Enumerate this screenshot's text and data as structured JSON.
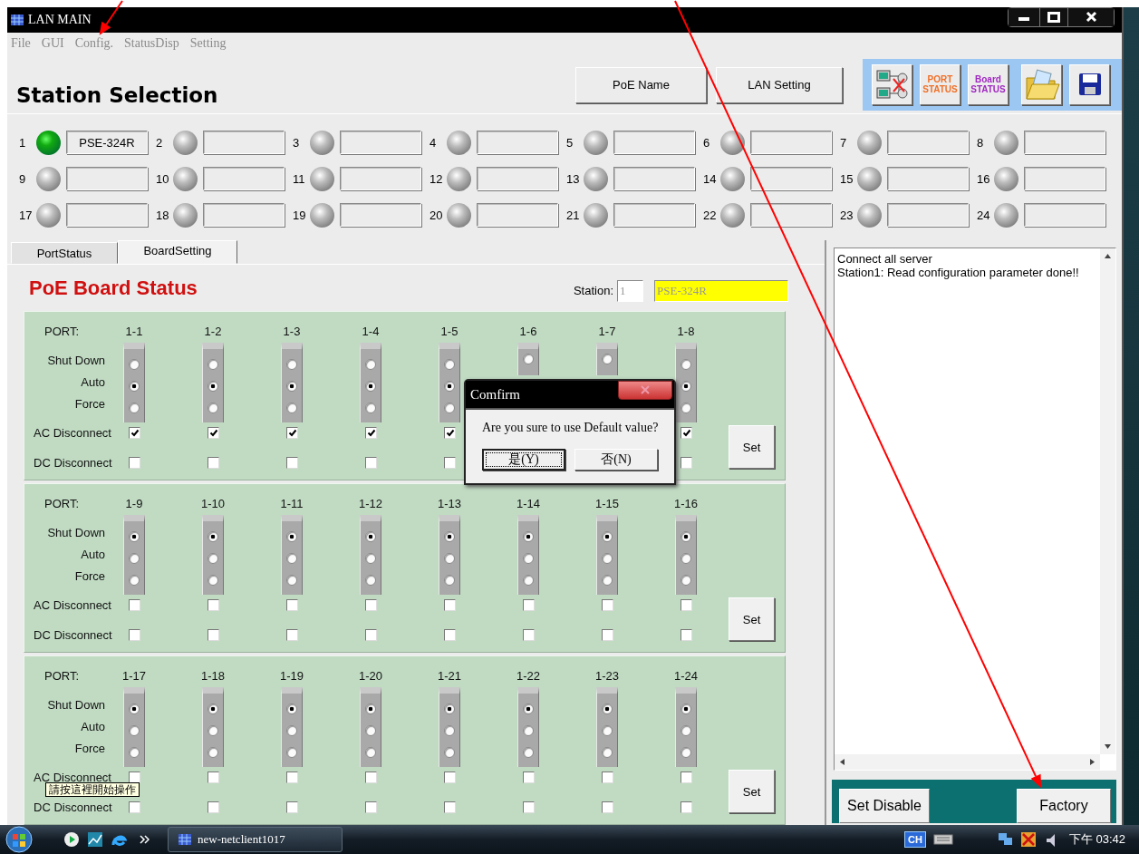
{
  "window": {
    "title": "LAN MAIN"
  },
  "menu": [
    {
      "label": "File",
      "disabled": true
    },
    {
      "label": "GUI",
      "disabled": true
    },
    {
      "label": "Config.",
      "disabled": true
    },
    {
      "label": "StatusDisp",
      "disabled": true
    },
    {
      "label": "Setting",
      "disabled": true
    }
  ],
  "header": {
    "title": "Station Selection",
    "buttons": [
      "PoE Name",
      "LAN Setting"
    ]
  },
  "toolbar": [
    {
      "kind": "network"
    },
    {
      "kind": "label",
      "lines": [
        "PORT",
        "STATUS"
      ],
      "color": "#f07028"
    },
    {
      "kind": "label",
      "lines": [
        "Board",
        "STATUS"
      ],
      "color": "#a028c0"
    },
    {
      "kind": "folder"
    },
    {
      "kind": "save"
    }
  ],
  "stations": [
    {
      "number": "1",
      "name": "PSE-324R",
      "online": true
    },
    {
      "number": "2",
      "online": false
    },
    {
      "number": "3",
      "online": false
    },
    {
      "number": "4",
      "online": false
    },
    {
      "number": "5",
      "online": false
    },
    {
      "number": "6",
      "online": false
    },
    {
      "number": "7",
      "online": false
    },
    {
      "number": "8",
      "online": false
    },
    {
      "number": "9",
      "online": false
    },
    {
      "number": "10",
      "online": false
    },
    {
      "number": "11",
      "online": false
    },
    {
      "number": "12",
      "online": false
    },
    {
      "number": "13",
      "online": false
    },
    {
      "number": "14",
      "online": false
    },
    {
      "number": "15",
      "online": false
    },
    {
      "number": "16",
      "online": false
    },
    {
      "number": "17",
      "online": false
    },
    {
      "number": "18",
      "online": false
    },
    {
      "number": "19",
      "online": false
    },
    {
      "number": "20",
      "online": false
    },
    {
      "number": "21",
      "online": false
    },
    {
      "number": "22",
      "online": false
    },
    {
      "number": "23",
      "online": false
    },
    {
      "number": "24",
      "online": false
    }
  ],
  "tabs": [
    {
      "label": "PortStatus",
      "selected": false
    },
    {
      "label": "BoardSetting",
      "selected": true
    }
  ],
  "board": {
    "title": "PoE Board Status",
    "station": {
      "label": "Station:",
      "number": "1",
      "name": "PSE-324R"
    },
    "groups": [
      {
        "labels": {
          "port": "PORT:",
          "modes": [
            "Shut Down",
            "Auto",
            "Force"
          ],
          "ac": "AC Disconnect",
          "dc": "DC Disconnect"
        },
        "button": "Set",
        "ports": [
          {
            "label": "1-1",
            "options": [
              false,
              true,
              false
            ],
            "ac": true,
            "dc": false
          },
          {
            "label": "1-2",
            "options": [
              false,
              true,
              false
            ],
            "ac": true,
            "dc": false
          },
          {
            "label": "1-3",
            "options": [
              false,
              true,
              false
            ],
            "ac": true,
            "dc": false
          },
          {
            "label": "1-4",
            "options": [
              false,
              true,
              false
            ],
            "ac": true,
            "dc": false
          },
          {
            "label": "1-5",
            "options": [
              false,
              true,
              false
            ],
            "ac": true,
            "dc": false
          },
          {
            "label": "1-6",
            "options": [
              false
            ]
          },
          {
            "label": "1-7",
            "options": [
              false
            ]
          },
          {
            "label": "1-8",
            "options": [
              false,
              true,
              false
            ],
            "ac": true,
            "dc": false
          }
        ]
      },
      {
        "labels": {
          "port": "PORT:",
          "modes": [
            "Shut Down",
            "Auto",
            "Force"
          ],
          "ac": "AC Disconnect",
          "dc": "DC Disconnect"
        },
        "button": "Set",
        "ports": [
          {
            "label": "1-9",
            "options": [
              true,
              false,
              false
            ],
            "ac": false,
            "dc": false
          },
          {
            "label": "1-10",
            "options": [
              true,
              false,
              false
            ],
            "ac": false,
            "dc": false
          },
          {
            "label": "1-11",
            "options": [
              true,
              false,
              false
            ],
            "ac": false,
            "dc": false
          },
          {
            "label": "1-12",
            "options": [
              true,
              false,
              false
            ],
            "ac": false,
            "dc": false
          },
          {
            "label": "1-13",
            "options": [
              true,
              false,
              false
            ],
            "ac": false,
            "dc": false
          },
          {
            "label": "1-14",
            "options": [
              true,
              false,
              false
            ],
            "ac": false,
            "dc": false
          },
          {
            "label": "1-15",
            "options": [
              true,
              false,
              false
            ],
            "ac": false,
            "dc": false
          },
          {
            "label": "1-16",
            "options": [
              true,
              false,
              false
            ],
            "ac": false,
            "dc": false
          }
        ]
      },
      {
        "labels": {
          "port": "PORT:",
          "modes": [
            "Shut Down",
            "Auto",
            "Force"
          ],
          "ac": "AC Disconnect",
          "dc": "DC Disconnect"
        },
        "button": "Set",
        "ports": [
          {
            "label": "1-17",
            "options": [
              true,
              false,
              false
            ],
            "ac": false,
            "dc": false
          },
          {
            "label": "1-18",
            "options": [
              true,
              false,
              false
            ],
            "ac": false,
            "dc": false
          },
          {
            "label": "1-19",
            "options": [
              true,
              false,
              false
            ],
            "ac": false,
            "dc": false
          },
          {
            "label": "1-20",
            "options": [
              true,
              false,
              false
            ],
            "ac": false,
            "dc": false
          },
          {
            "label": "1-21",
            "options": [
              true,
              false,
              false
            ],
            "ac": false,
            "dc": false
          },
          {
            "label": "1-22",
            "options": [
              true,
              false,
              false
            ],
            "ac": false,
            "dc": false
          },
          {
            "label": "1-23",
            "options": [
              true,
              false,
              false
            ],
            "ac": false,
            "dc": false
          },
          {
            "label": "1-24",
            "options": [
              true,
              false,
              false
            ],
            "ac": false,
            "dc": false
          }
        ]
      }
    ]
  },
  "log": {
    "lines": [
      "Connect all server",
      "Station1: Read configuration parameter done!!"
    ]
  },
  "footer": {
    "buttons": [
      "Set Disable",
      "Factory"
    ]
  },
  "dialog": {
    "title": "Comfirm",
    "message": "Are you sure to use Default value?",
    "buttons": [
      {
        "label": "是(Y)",
        "focused": true
      },
      {
        "label": "否(N)",
        "focused": false
      }
    ]
  },
  "tooltip": "請按這裡開始操作",
  "taskbar": {
    "tasks": [
      {
        "label": "new-netclient1017"
      }
    ],
    "language": "CH",
    "clock": "下午 03:42"
  },
  "annotations": [
    {
      "kind": "arrow"
    },
    {
      "kind": "arrow"
    }
  ]
}
